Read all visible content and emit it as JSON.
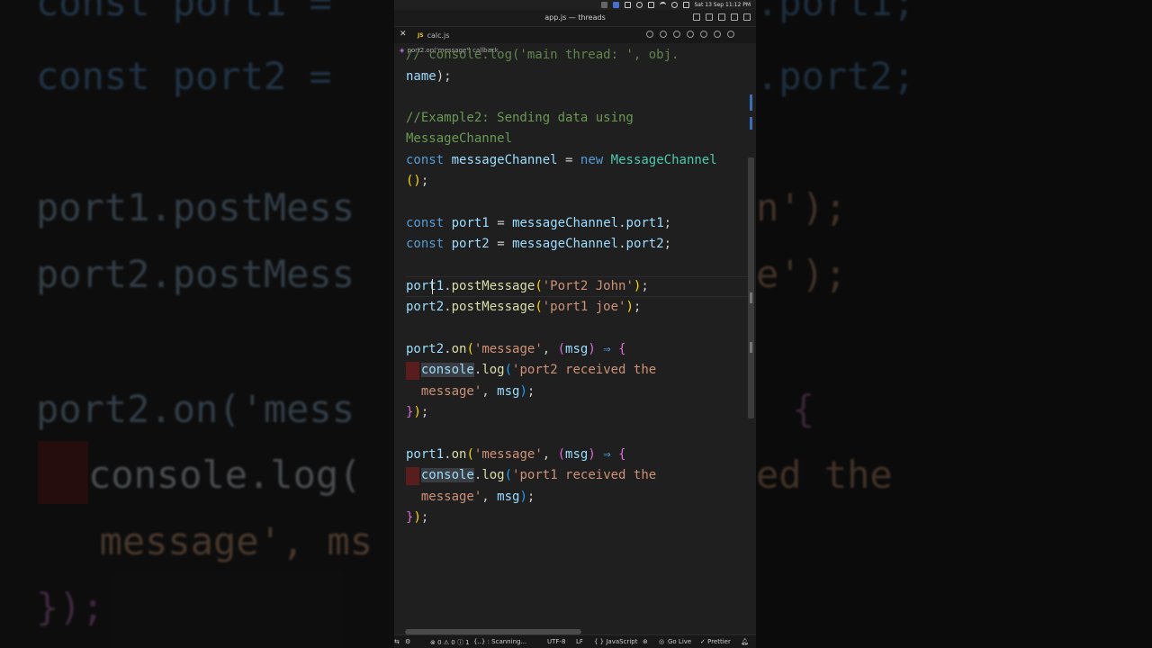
{
  "window": {
    "title": "app.js — threads"
  },
  "menubar": {
    "datetime": "Sat 13 Sep  11:12 PM"
  },
  "tabs": [
    {
      "icon": "JS",
      "label": "calc.js"
    }
  ],
  "breadcrumb": {
    "label": "port2.on('message') callback"
  },
  "code": {
    "l0": "// console.log('main thread: ', obj.",
    "l1_a": "name",
    "l1_b": ");",
    "l2": "//Example2: Sending data using",
    "l3": "MessageChannel",
    "l4_const": "const",
    "l4_var": "messageChannel",
    "l4_eq": "=",
    "l4_new": "new",
    "l4_cls": "MessageChannel",
    "l5_a": "()",
    "l5_b": ";",
    "l6_const": "const",
    "l6_var": "port1",
    "l6_eq": "=",
    "l6_obj": "messageChannel",
    "l6_prop": "port1",
    "l6_end": ";",
    "l7_const": "const",
    "l7_var": "port2",
    "l7_eq": "=",
    "l7_obj": "messageChannel",
    "l7_prop": "port2",
    "l7_end": ";",
    "l8_obj": "port1",
    "l8_fn": "postMessage",
    "l8_str": "'Port2 John'",
    "l9_obj": "port2",
    "l9_fn": "postMessage",
    "l9_str": "'port1 joe'",
    "l10_obj": "port2",
    "l10_fn": "on",
    "l10_str": "'message'",
    "l10_param": "msg",
    "l10_arrow": "⇒",
    "l11_obj": "console",
    "l11_fn": "log",
    "l11_str": "'port2 received the",
    "l12_str": "message'",
    "l12_param": "msg",
    "l13": "});",
    "l14_obj": "port1",
    "l14_fn": "on",
    "l14_str": "'message'",
    "l14_param": "msg",
    "l14_arrow": "⇒",
    "l15_obj": "console",
    "l15_fn": "log",
    "l15_str": "'port1 received the",
    "l16_str": "message'",
    "l16_param": "msg",
    "l17": "});"
  },
  "background": {
    "left": {
      "r0": "const port1 =",
      "r1": "const port2 =",
      "r2": "port1.postMess",
      "r3": "port2.postMess",
      "r4": "port2.on('mess",
      "r5": "console.log(",
      "r6": "  message', ms",
      "r7": "});"
    },
    "right": {
      "r0": ".port1;",
      "r1": ".port2;",
      "r2": "n');",
      "r3": "e');",
      "r4": "{",
      "r5": "ed the"
    }
  },
  "statusbar": {
    "problems": "⊗ 0 ⚠ 0  ⓘ 1",
    "scanning": "{..} : Scanning...",
    "encoding": "UTF-8",
    "eol": "LF",
    "language": "{ } JavaScript",
    "golive": "Go Live",
    "prettier": "✓ Prettier"
  },
  "colors": {
    "editor_bg": "#1f1f1f",
    "keyword": "#569cd6",
    "variable": "#9cdcfe",
    "class": "#4ec9b0",
    "function": "#dcdcaa",
    "string": "#ce9178",
    "comment": "#6a9955"
  }
}
